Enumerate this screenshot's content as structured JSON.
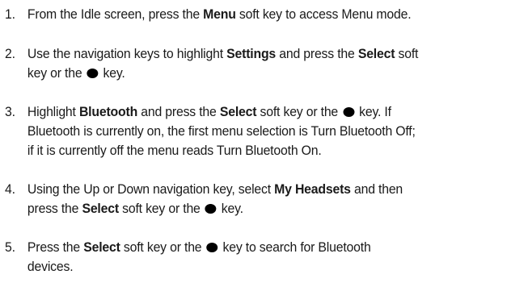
{
  "steps": [
    {
      "number": "1.",
      "lines": [
        [
          {
            "t": "From the Idle screen, press the "
          },
          {
            "t": "Menu",
            "b": true
          },
          {
            "t": " soft key to access Menu mode."
          }
        ]
      ]
    },
    {
      "number": "2.",
      "lines": [
        [
          {
            "t": "Use the navigation keys to highlight "
          },
          {
            "t": "Settings",
            "b": true
          },
          {
            "t": " and press the "
          },
          {
            "t": "Select",
            "b": true
          },
          {
            "t": " soft"
          }
        ],
        [
          {
            "t": "key or the "
          },
          {
            "icon": "center-key-icon"
          },
          {
            "t": " key."
          }
        ]
      ]
    },
    {
      "number": "3.",
      "lines": [
        [
          {
            "t": "Highlight "
          },
          {
            "t": "Bluetooth",
            "b": true
          },
          {
            "t": " and press the "
          },
          {
            "t": "Select",
            "b": true
          },
          {
            "t": " soft key or the "
          },
          {
            "icon": "center-key-icon"
          },
          {
            "t": " key. If"
          }
        ],
        [
          {
            "t": "Bluetooth is currently on, the first menu selection is Turn Bluetooth Off;"
          }
        ],
        [
          {
            "t": "if it is currently off the menu reads Turn Bluetooth On."
          }
        ]
      ]
    },
    {
      "number": "4.",
      "lines": [
        [
          {
            "t": "Using the Up or Down navigation key, select "
          },
          {
            "t": "My Headsets",
            "b": true
          },
          {
            "t": " and then"
          }
        ],
        [
          {
            "t": "press the "
          },
          {
            "t": "Select",
            "b": true
          },
          {
            "t": " soft key or the "
          },
          {
            "icon": "center-key-icon"
          },
          {
            "t": " key."
          }
        ]
      ]
    },
    {
      "number": "5.",
      "lines": [
        [
          {
            "t": "Press the "
          },
          {
            "t": "Select",
            "b": true
          },
          {
            "t": " soft key or the "
          },
          {
            "icon": "center-key-icon"
          },
          {
            "t": " key to search for Bluetooth"
          }
        ],
        [
          {
            "t": "devices."
          }
        ]
      ]
    }
  ]
}
